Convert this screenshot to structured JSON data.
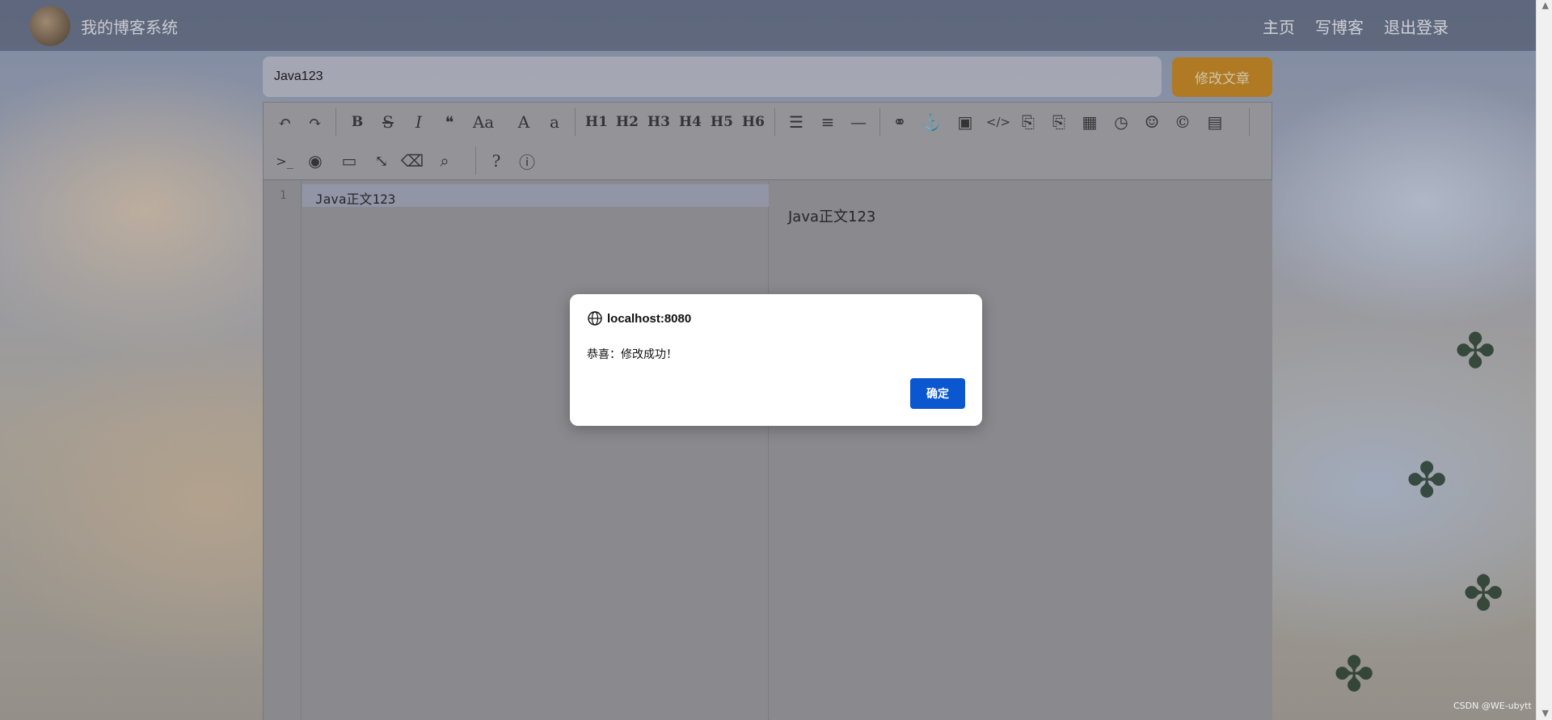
{
  "header": {
    "site_title": "我的博客系统",
    "nav": [
      "主页",
      "写博客",
      "退出登录"
    ]
  },
  "editor": {
    "title_value": "Java123",
    "submit_label": "修改文章",
    "toolbar_icons": [
      "undo-icon",
      "redo-icon",
      "bold-icon",
      "strikethrough-icon",
      "italic-icon",
      "quote-icon",
      "uppercase-icon",
      "heading-A-icon",
      "lowercase-icon",
      "h1-icon",
      "h2-icon",
      "h3-icon",
      "h4-icon",
      "h5-icon",
      "h6-icon",
      "unordered-list-icon",
      "ordered-list-icon",
      "horizontal-rule-icon",
      "link-icon",
      "anchor-icon",
      "image-icon",
      "code-icon",
      "preformatted-code-icon",
      "code-block-icon",
      "table-icon",
      "datetime-icon",
      "emoji-icon",
      "html-entities-icon",
      "pagebreak-icon",
      "goto-line-icon",
      "watch-toggle-icon",
      "preview-icon",
      "fullscreen-icon",
      "clear-icon",
      "search-icon",
      "help-icon",
      "info-icon"
    ],
    "toolbar_labels": {
      "bold": "B",
      "italic": "I",
      "uppercase": "Aa",
      "heading_a": "A",
      "lowercase": "a",
      "h1": "H1",
      "h2": "H2",
      "h3": "H3",
      "h4": "H4",
      "h5": "H5",
      "h6": "H6"
    },
    "line_number": "1",
    "content": "Java正文123",
    "preview": "Java正文123"
  },
  "dialog": {
    "origin": "localhost:8080",
    "message": "恭喜：修改成功！",
    "ok_label": "确定"
  },
  "watermark": "CSDN @WE-ubytt"
}
